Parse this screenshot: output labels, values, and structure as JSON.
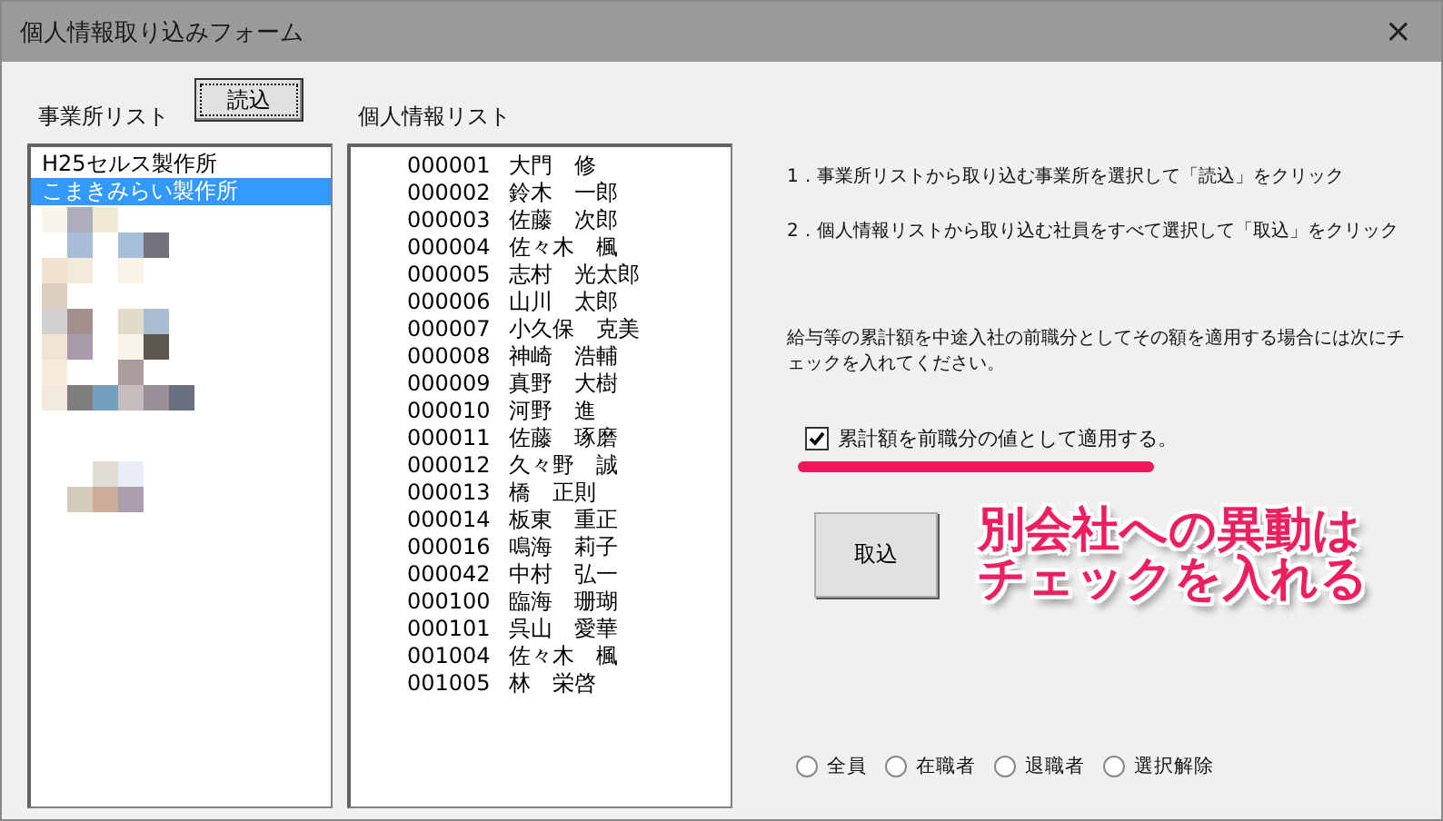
{
  "window": {
    "title": "個人情報取り込みフォーム",
    "close": "×"
  },
  "office_list": {
    "label": "事業所リスト",
    "load_button": "読込",
    "items": [
      {
        "name": "H25セルス製作所",
        "selected": false
      },
      {
        "name": "こまきみらい製作所",
        "selected": true
      }
    ]
  },
  "person_list": {
    "label": "個人情報リスト",
    "items": [
      {
        "code": "000001",
        "name": "大門　修",
        "selected": false
      },
      {
        "code": "000002",
        "name": "鈴木　一郎",
        "selected": false
      },
      {
        "code": "000003",
        "name": "佐藤　次郎",
        "selected": false
      },
      {
        "code": "000004",
        "name": "佐々木　楓",
        "selected": false
      },
      {
        "code": "000005",
        "name": "志村　光太郎",
        "selected": false
      },
      {
        "code": "000006",
        "name": "山川　太郎",
        "selected": false
      },
      {
        "code": "000007",
        "name": "小久保　克美",
        "selected": false
      },
      {
        "code": "000008",
        "name": "神崎　浩輔",
        "selected": false
      },
      {
        "code": "000009",
        "name": "真野　大樹",
        "selected": false
      },
      {
        "code": "000010",
        "name": "河野　進",
        "selected": false
      },
      {
        "code": "000011",
        "name": "佐藤　琢磨",
        "selected": false
      },
      {
        "code": "000012",
        "name": "久々野　誠",
        "selected": false
      },
      {
        "code": "000013",
        "name": "橋　正則",
        "selected": false
      },
      {
        "code": "000014",
        "name": "板東　重正",
        "selected": false
      },
      {
        "code": "000016",
        "name": "鳴海　莉子",
        "selected": false
      },
      {
        "code": "000042",
        "name": "中村　弘一",
        "selected": false
      },
      {
        "code": "000100",
        "name": "臨海　珊瑚",
        "selected": false
      },
      {
        "code": "000101",
        "name": "呉山　愛華",
        "selected": false
      },
      {
        "code": "001004",
        "name": "佐々木　楓",
        "selected": false
      },
      {
        "code": "001005",
        "name": "林　栄啓",
        "selected": false
      }
    ]
  },
  "instructions": [
    "1．事業所リストから取り込む事業所を選択して「読込」をクリック",
    "2．個人情報リストから取り込む社員をすべて選択して「取込」をクリック"
  ],
  "note": "給与等の累計額を中途入社の前職分としてその額を適用する場合には次にチェックを入れてください。",
  "apply_checkbox": {
    "label": "累計額を前職分の値として適用する。",
    "checked": true
  },
  "import_button": "取込",
  "annotation": [
    "別会社への異動は",
    "チェックを入れる"
  ],
  "filter_radios": [
    {
      "label": "全員",
      "selected": false
    },
    {
      "label": "在職者",
      "selected": false
    },
    {
      "label": "退職者",
      "selected": false
    },
    {
      "label": "選択解除",
      "selected": false
    }
  ]
}
